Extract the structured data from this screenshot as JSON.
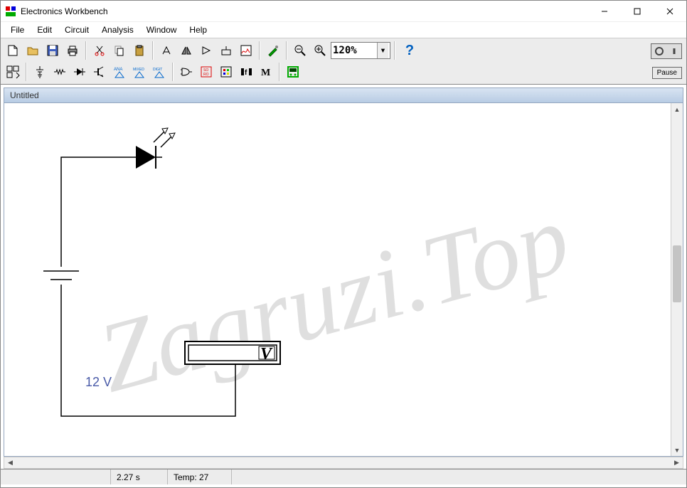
{
  "window": {
    "title": "Electronics Workbench"
  },
  "menu": {
    "items": [
      "File",
      "Edit",
      "Circuit",
      "Analysis",
      "Window",
      "Help"
    ]
  },
  "toolbar": {
    "zoom": "120%",
    "help_tooltip": "?",
    "pause_label": "Pause"
  },
  "document": {
    "title": "Untitled"
  },
  "circuit": {
    "voltage_source_label": "12 V",
    "voltmeter_unit": "V"
  },
  "status": {
    "time": "2.27 s",
    "temp": "Temp:  27"
  }
}
